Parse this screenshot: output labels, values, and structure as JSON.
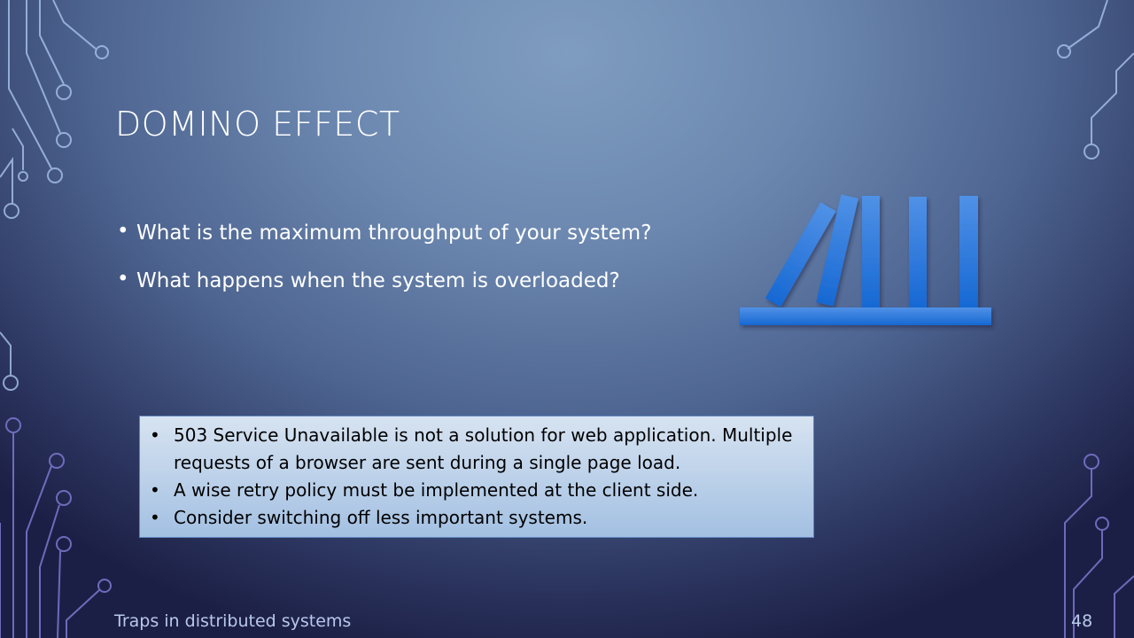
{
  "slide": {
    "title": "DOMINO EFFECT",
    "bullets": [
      "What is the maximum throughput of your system?",
      "What happens when the system is overloaded?"
    ],
    "note_box": {
      "items": [
        "503 Service Unavailable is not a solution for web application. Multiple requests of a browser are sent during a single page load.",
        "A wise retry policy must be implemented at the client side.",
        "Consider switching off less important systems."
      ]
    },
    "footer": "Traps in distributed systems",
    "page_number": "48",
    "illustration": "falling-dominoes",
    "colors": {
      "domino": "#2f7ae0",
      "box_fill": "#c4d6ec"
    }
  }
}
